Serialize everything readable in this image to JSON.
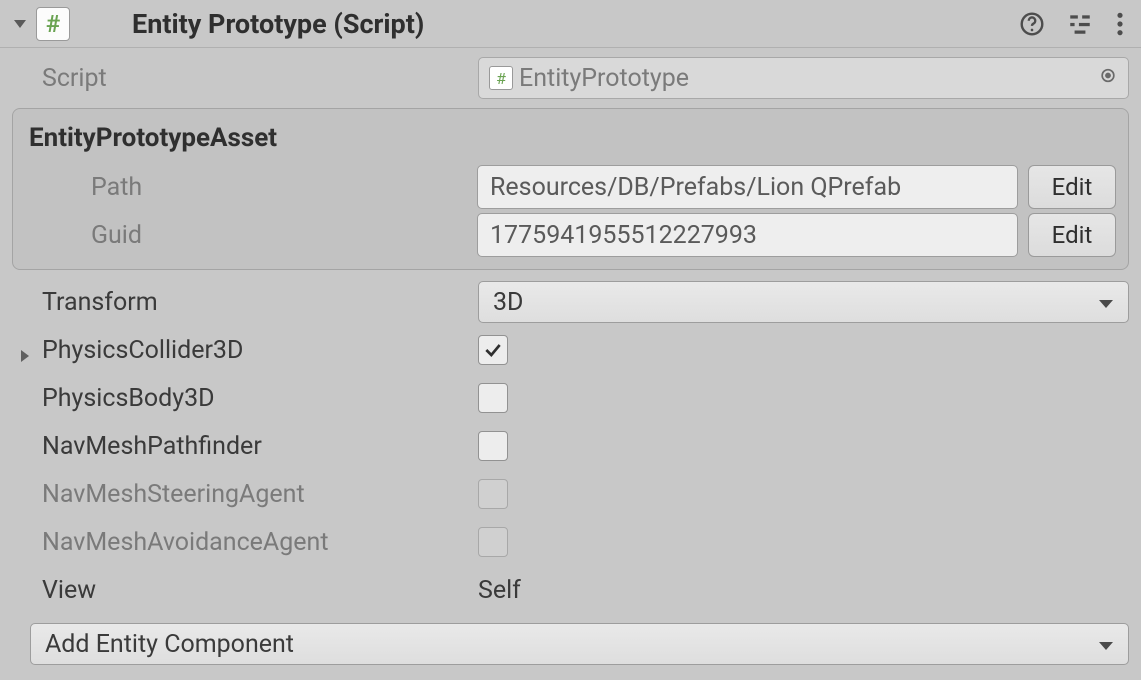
{
  "header": {
    "title": "Entity Prototype (Script)"
  },
  "scriptRow": {
    "label": "Script",
    "value": "EntityPrototype"
  },
  "assetGroup": {
    "title": "EntityPrototypeAsset",
    "path": {
      "label": "Path",
      "value": "Resources/DB/Prefabs/Lion QPrefab",
      "button": "Edit"
    },
    "guid": {
      "label": "Guid",
      "value": "1775941955512227993",
      "button": "Edit"
    }
  },
  "transform": {
    "label": "Transform",
    "value": "3D"
  },
  "physicsCollider3D": {
    "label": "PhysicsCollider3D",
    "checked": true
  },
  "physicsBody3D": {
    "label": "PhysicsBody3D",
    "checked": false
  },
  "navMeshPathfinder": {
    "label": "NavMeshPathfinder",
    "checked": false
  },
  "navMeshSteeringAgent": {
    "label": "NavMeshSteeringAgent",
    "checked": false
  },
  "navMeshAvoidanceAgent": {
    "label": "NavMeshAvoidanceAgent",
    "checked": false
  },
  "view": {
    "label": "View",
    "value": "Self"
  },
  "addComponent": {
    "label": "Add Entity Component"
  }
}
